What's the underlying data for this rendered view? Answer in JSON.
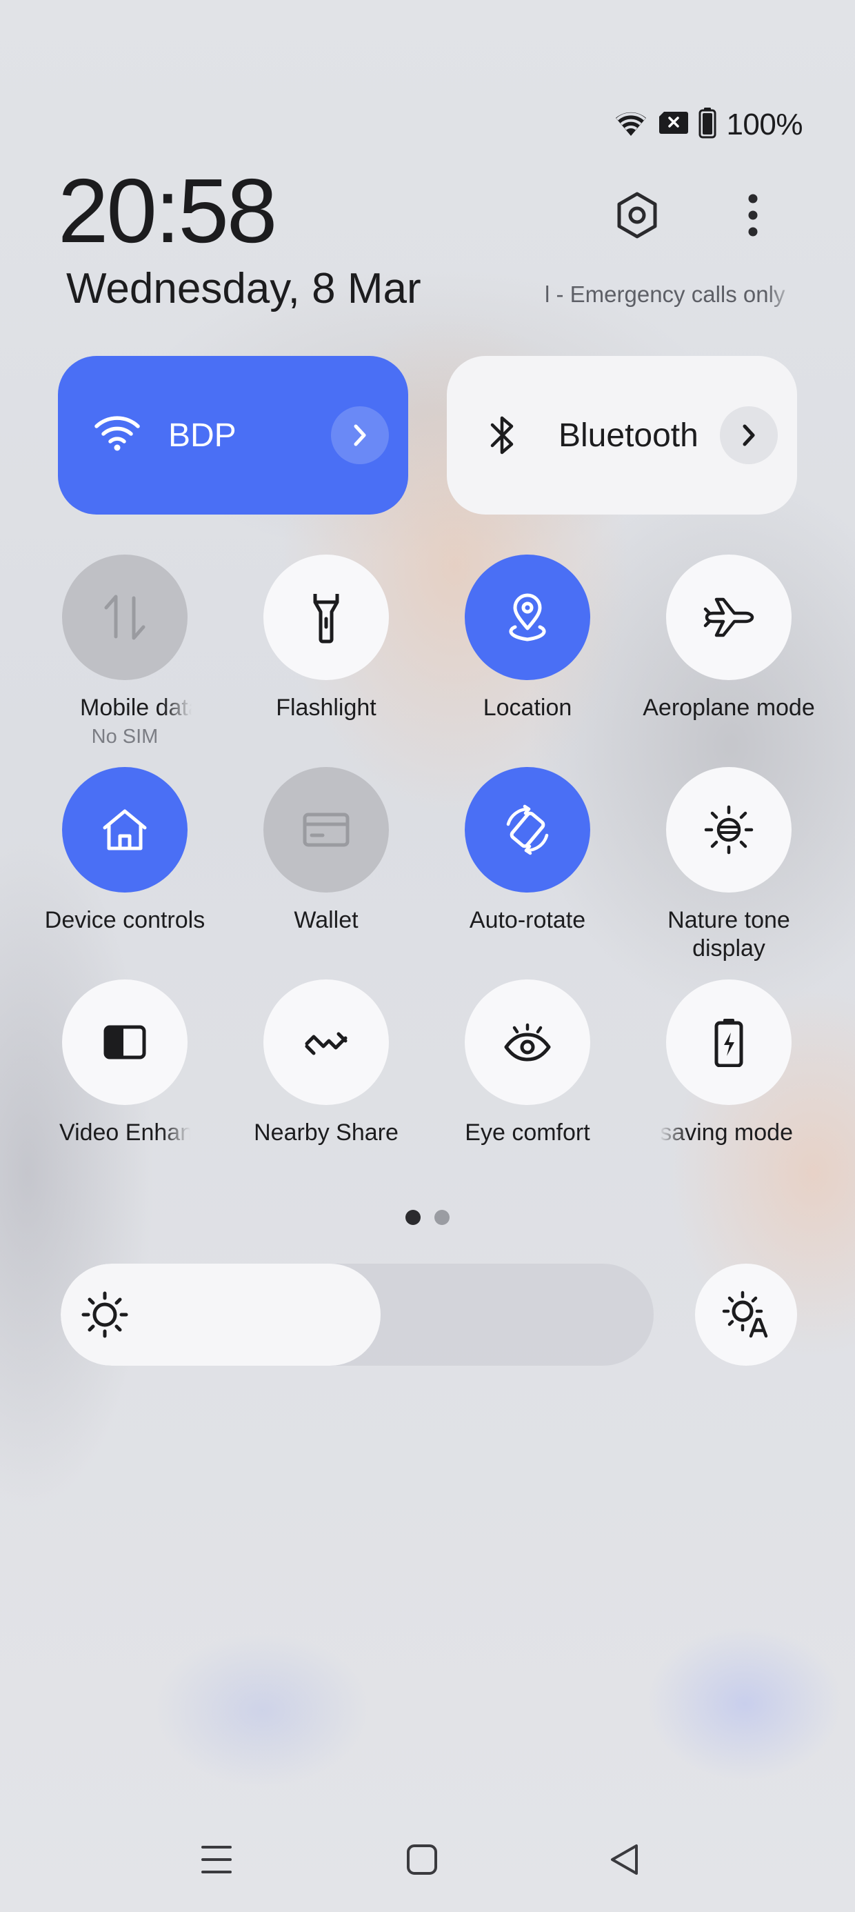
{
  "status_bar": {
    "battery_text": "100%",
    "icons": [
      "wifi-icon",
      "no-sim-icon",
      "battery-icon"
    ]
  },
  "header": {
    "time": "20:58",
    "date": "Wednesday, 8 Mar",
    "carrier_text": "l - Emergency calls only",
    "settings_icon": "settings-icon",
    "more_icon": "more-vertical-icon"
  },
  "big_tiles": {
    "wifi": {
      "label": "BDP",
      "active": true
    },
    "bluetooth": {
      "label": "Bluetooth",
      "active": false
    }
  },
  "tiles": [
    {
      "label": "Mobile data",
      "sub": "No SIM",
      "state": "disabled",
      "icon": "mobile-data-icon"
    },
    {
      "label": "Flashlight",
      "state": "off",
      "icon": "flashlight-icon"
    },
    {
      "label": "Location",
      "state": "on",
      "icon": "location-icon"
    },
    {
      "label": "Aeroplane mode",
      "state": "off",
      "icon": "airplane-icon"
    },
    {
      "label": "Device controls",
      "state": "on",
      "icon": "home-icon"
    },
    {
      "label": "Wallet",
      "state": "disabled",
      "icon": "wallet-icon"
    },
    {
      "label": "Auto-rotate",
      "state": "on",
      "icon": "auto-rotate-icon"
    },
    {
      "label": "Nature tone display",
      "state": "off",
      "icon": "nature-tone-icon"
    },
    {
      "label": "Video Enhancer",
      "state": "off",
      "icon": "video-enhance-icon"
    },
    {
      "label": "Nearby Share",
      "state": "off",
      "icon": "nearby-share-icon"
    },
    {
      "label": "Eye comfort",
      "state": "off",
      "icon": "eye-icon"
    },
    {
      "label": "Power saving mode",
      "state": "off",
      "icon": "battery-saver-icon"
    }
  ],
  "pager": {
    "pages": 2,
    "current": 1
  },
  "brightness": {
    "level": 0.54
  },
  "colors": {
    "accent": "#4a6ff5",
    "tile_off": "#f8f8fa",
    "tile_disabled": "#bfc0c5",
    "text": "#1c1c1e"
  },
  "nav": {
    "buttons": [
      "recents-icon",
      "home-button-icon",
      "back-icon"
    ]
  }
}
